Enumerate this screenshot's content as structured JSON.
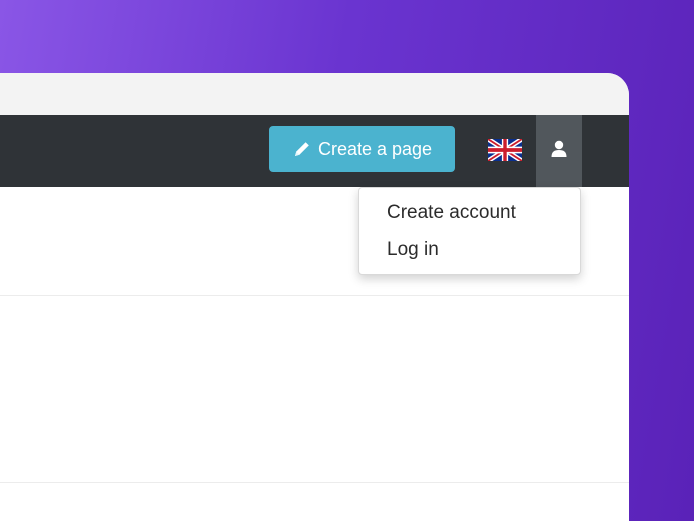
{
  "navbar": {
    "create_label": "Create a page",
    "create_icon": "pencil-icon",
    "language_icon": "uk-flag-icon",
    "user_icon": "user-icon"
  },
  "user_menu": {
    "items": [
      {
        "label": "Create account"
      },
      {
        "label": "Log in"
      }
    ]
  },
  "colors": {
    "background_gradient_start": "#8a56e6",
    "background_gradient_end": "#5a22b8",
    "navbar": "#2f3337",
    "create_button": "#4bb3cf",
    "user_button": "#51575c",
    "window": "#ffffff"
  }
}
